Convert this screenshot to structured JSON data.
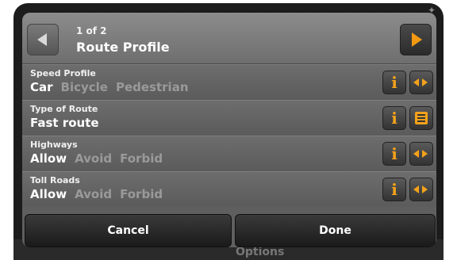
{
  "header": {
    "page_count": "1 of 2",
    "title": "Route Profile"
  },
  "rows": [
    {
      "label": "Speed Profile",
      "options": [
        "Car",
        "Bicycle",
        "Pedestrian"
      ],
      "selected": "Car",
      "action_icon": "left-right-arrows-icon"
    },
    {
      "label": "Type of Route",
      "options": [
        "Fast route"
      ],
      "selected": "Fast route",
      "action_icon": "list-icon"
    },
    {
      "label": "Highways",
      "options": [
        "Allow",
        "Avoid",
        "Forbid"
      ],
      "selected": "Allow",
      "action_icon": "left-right-arrows-icon"
    },
    {
      "label": "Toll Roads",
      "options": [
        "Allow",
        "Avoid",
        "Forbid"
      ],
      "selected": "Allow",
      "action_icon": "left-right-arrows-icon"
    }
  ],
  "footer": {
    "cancel_label": "Cancel",
    "done_label": "Done"
  },
  "background": {
    "options_label": "Options"
  },
  "colors": {
    "accent": "#f5a21a",
    "selected_text": "#ffffff",
    "unselected_text": "#9a9a9a"
  }
}
